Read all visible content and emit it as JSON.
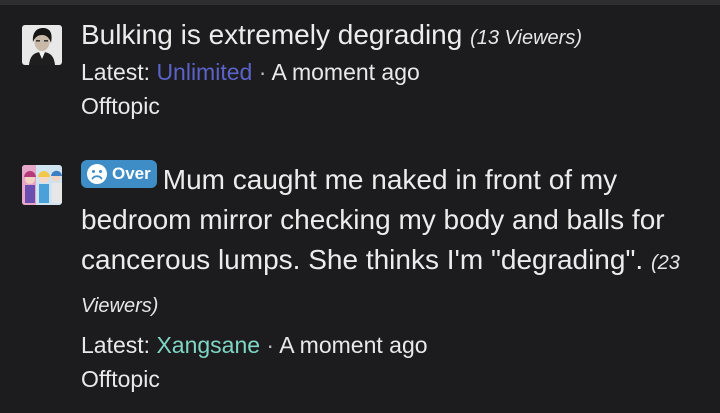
{
  "threads": [
    {
      "avatar_icon": "user-avatar-portrait",
      "title": "Bulking is extremely degrading",
      "viewers": "(13 Viewers)",
      "latest_label": "Latest:",
      "latest_user": "Unlimited",
      "separator": "·",
      "time": "A moment ago",
      "forum": "Offtopic"
    },
    {
      "avatar_icon": "user-avatar-anime",
      "prefix": {
        "icon": "sad-face-icon",
        "label": "Over"
      },
      "title": "Mum caught me naked in front of my bedroom mirror checking my body and balls for cancerous lumps. She thinks I'm \"degrading\".",
      "viewers": "(23 Viewers)",
      "latest_label": "Latest:",
      "latest_user": "Xangsane",
      "separator": "·",
      "time": "A moment ago",
      "forum": "Offtopic"
    }
  ],
  "colors": {
    "background": "#1c1c1e",
    "user_blue": "#5b63c9",
    "user_teal": "#7fd6c4",
    "prefix_bg": "#3f8dc7"
  }
}
